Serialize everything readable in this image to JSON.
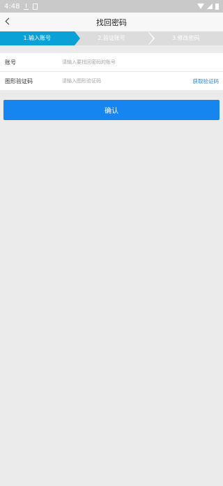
{
  "status_bar": {
    "time": "4:48",
    "icons": [
      "download-icon",
      "sim-icon",
      "wifi-icon",
      "signal-icon",
      "battery-icon"
    ]
  },
  "header": {
    "back_icon": "back-arrow-icon",
    "title": "找回密码"
  },
  "steps": [
    {
      "label": "1.输入账号",
      "active": true
    },
    {
      "label": "2.验证账号",
      "active": false
    },
    {
      "label": "3.修改密码",
      "active": false
    }
  ],
  "form": {
    "account": {
      "label": "账号",
      "placeholder": "请输入要找回密码的账号",
      "value": ""
    },
    "captcha": {
      "label": "图形验证码",
      "placeholder": "请输入图形验证码",
      "value": "",
      "action_label": "获取验证码"
    }
  },
  "confirm_label": "确认",
  "colors": {
    "accent": "#1685f0",
    "step_active": "#0aa1d6",
    "step_inactive": "#dcdcdc",
    "link": "#2a86d6",
    "background": "#ebebeb"
  }
}
